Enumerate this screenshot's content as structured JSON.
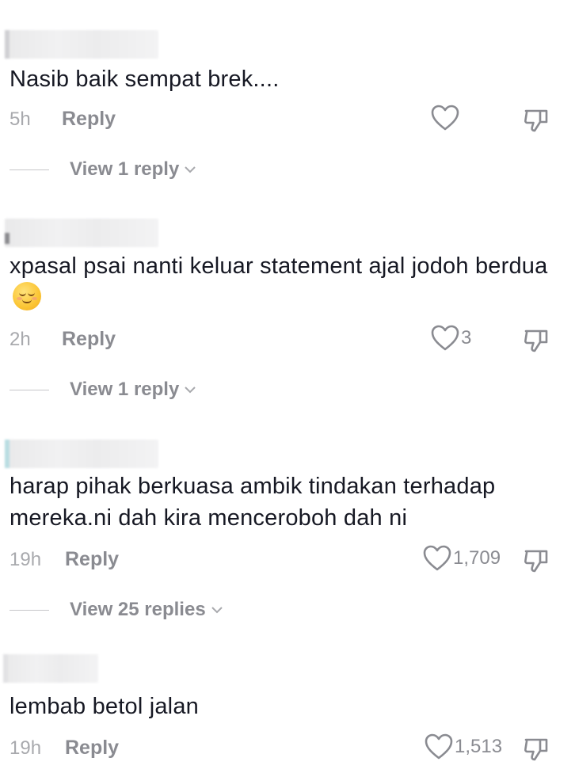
{
  "comments": [
    {
      "text": "Nasib baik sempat brek....",
      "time": "5h",
      "reply_label": "Reply",
      "likes": "",
      "view_replies": "View 1 reply"
    },
    {
      "text": "xpasal psai nanti keluar statement ajal jodoh berdua",
      "time": "2h",
      "reply_label": "Reply",
      "likes": "3",
      "view_replies": "View 1 reply"
    },
    {
      "text_line1": "harap pihak berkuasa ambik tindakan terhadap",
      "text_line2": "mereka.ni dah kira menceroboh dah ni",
      "time": "19h",
      "reply_label": "Reply",
      "likes": "1,709",
      "view_replies": "View 25 replies"
    },
    {
      "text": "lembab betol jalan",
      "time": "19h",
      "reply_label": "Reply",
      "likes": "1,513"
    }
  ],
  "icons": {
    "like": "heart-outline-icon",
    "dislike": "thumbs-down-icon",
    "expand": "chevron-down-icon",
    "emoji": "relieved-face-emoji"
  },
  "colors": {
    "text": "#161823",
    "muted": "#8a8b91"
  }
}
